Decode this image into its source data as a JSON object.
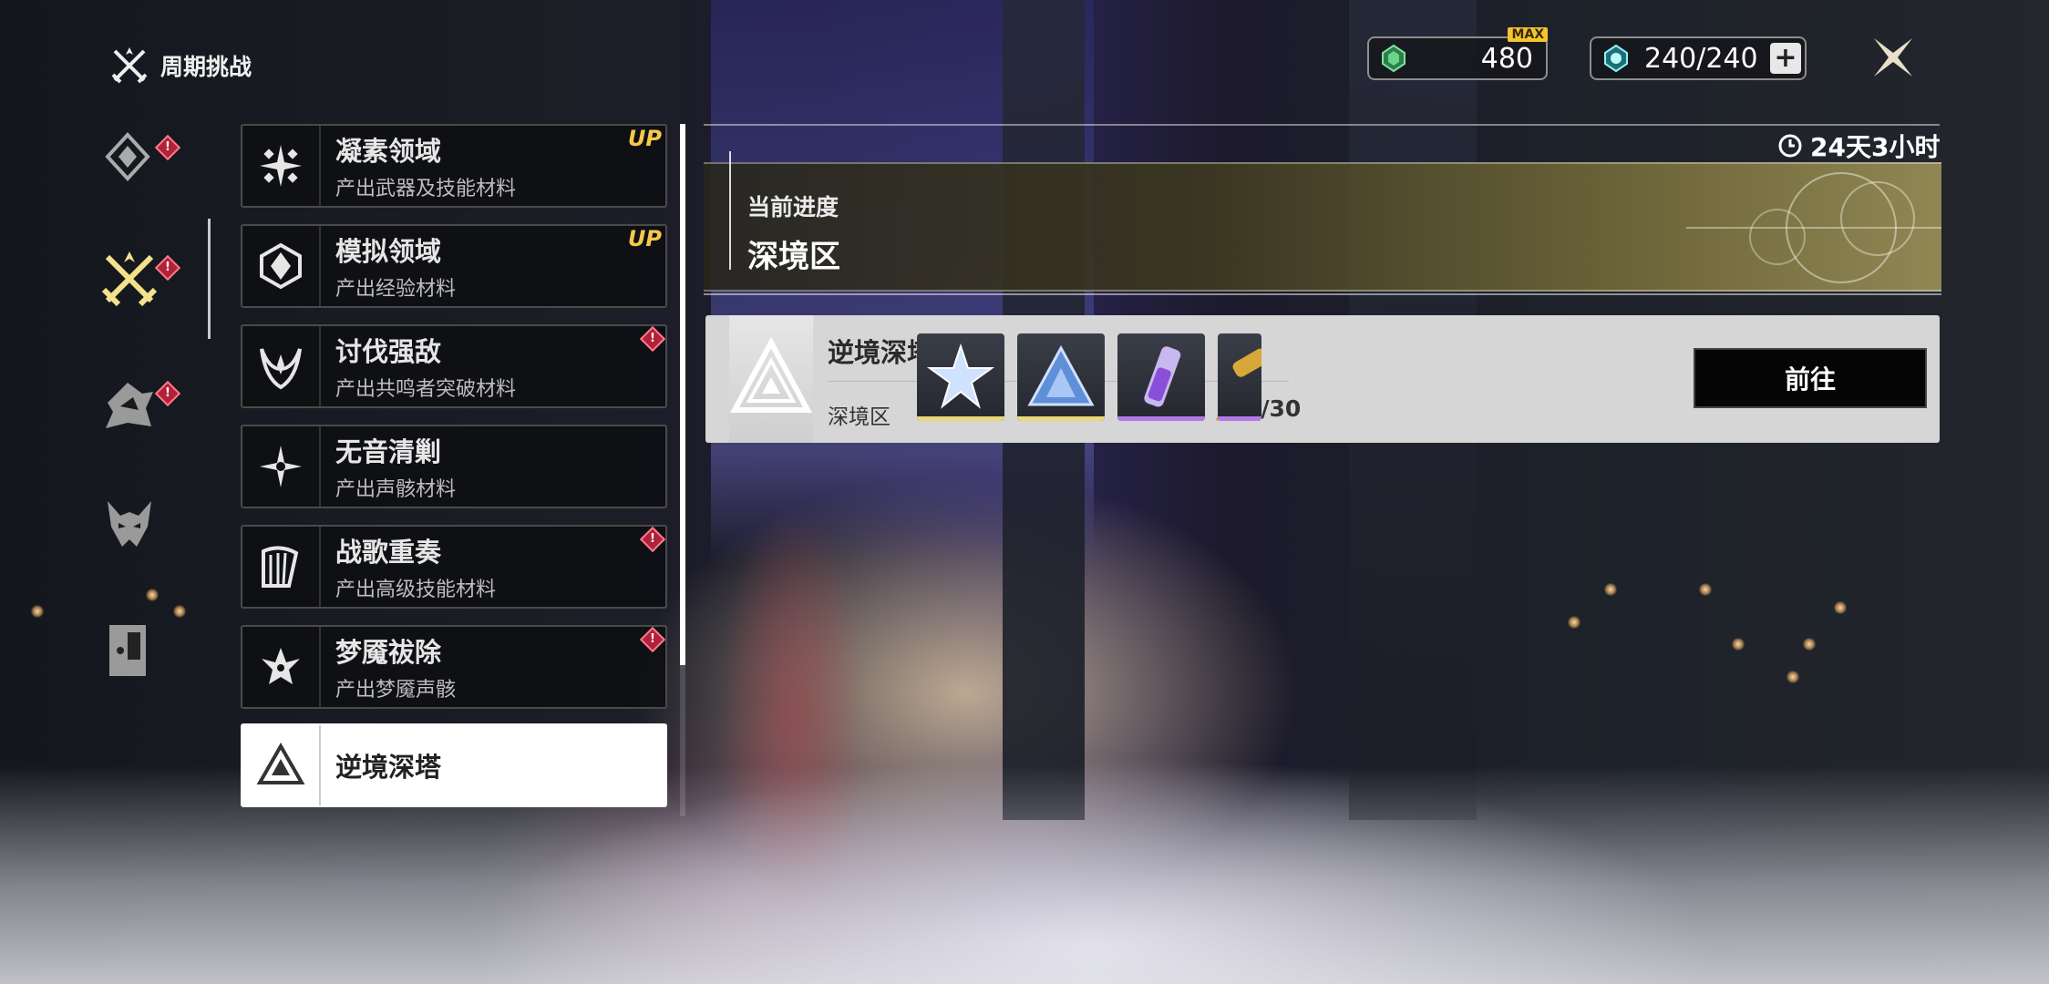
{
  "header": {
    "title": "周期挑战",
    "title_icon": "crossed-swords-icon"
  },
  "resources": {
    "waveplate_crystal": {
      "icon": "green-crystal-icon",
      "value": "480",
      "badge": "MAX"
    },
    "waveplate": {
      "icon": "cyan-gem-icon",
      "value": "240/240",
      "add_icon": "plus-icon"
    }
  },
  "close": {
    "icon": "close-star-icon"
  },
  "rail": [
    {
      "icon": "diamond-emblem-icon",
      "alert": "!"
    },
    {
      "icon": "crossed-swords-icon",
      "alert": "!",
      "active": true
    },
    {
      "icon": "shield-crest-icon",
      "alert": "!"
    },
    {
      "icon": "demon-mask-icon"
    },
    {
      "icon": "door-icon"
    }
  ],
  "categories": [
    {
      "name": "凝素领域",
      "desc": "产出武器及技能材料",
      "tag": "UP",
      "icon": "cross-diamond-icon"
    },
    {
      "name": "模拟领域",
      "desc": "产出经验材料",
      "tag": "UP",
      "icon": "hex-emblem-icon"
    },
    {
      "name": "讨伐强敌",
      "desc": "产出共鸣者突破材料",
      "alert": "!",
      "icon": "horned-crest-icon"
    },
    {
      "name": "无音清剿",
      "desc": "产出声骸材料",
      "icon": "spark-star-icon"
    },
    {
      "name": "战歌重奏",
      "desc": "产出高级技能材料",
      "alert": "!",
      "icon": "harp-icon"
    },
    {
      "name": "梦魇祓除",
      "desc": "产出梦魇声骸",
      "alert": "!",
      "icon": "nightmare-claw-icon"
    },
    {
      "name": "逆境深塔",
      "desc": "",
      "icon": "triangle-tower-icon",
      "active": true
    }
  ],
  "timer": {
    "icon": "clock-icon",
    "text": "24天3小时"
  },
  "progress": {
    "label": "当前进度",
    "value": "深境区"
  },
  "tower": {
    "name": "逆境深塔",
    "sub": "深境区",
    "count_icon": "triangle-star-icon",
    "count": "0/30",
    "rewards": [
      {
        "icon": "star-crystal-icon",
        "rarity_color": "#e8d878"
      },
      {
        "icon": "blue-pyramid-icon",
        "rarity_color": "#e8d878"
      },
      {
        "icon": "purple-tube-icon",
        "rarity_color": "#b478e8"
      },
      {
        "icon": "gold-tube-icon",
        "rarity_color": "#b478e8"
      }
    ],
    "go_label": "前往"
  }
}
